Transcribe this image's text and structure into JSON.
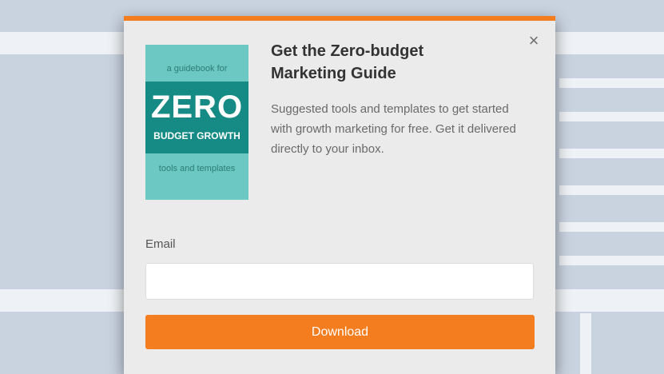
{
  "modal": {
    "close_glyph": "×",
    "title": "Get the Zero-budget Marketing Guide",
    "description": "Suggested tools and templates to get started with growth marketing for free. Get it delivered directly to your inbox.",
    "book": {
      "top_text": "a guidebook for",
      "big_text": "ZERO",
      "sub_text": "BUDGET GROWTH",
      "bottom_text": "tools and templates"
    },
    "email": {
      "label": "Email",
      "value": "",
      "placeholder": ""
    },
    "download_label": "Download"
  },
  "colors": {
    "accent": "#f47d1f",
    "book_light": "#6bc8c2",
    "book_dark": "#168a84",
    "modal_bg": "#ebebeb",
    "page_bg": "#c9d3e0"
  },
  "icons": {
    "close": "close-icon"
  }
}
